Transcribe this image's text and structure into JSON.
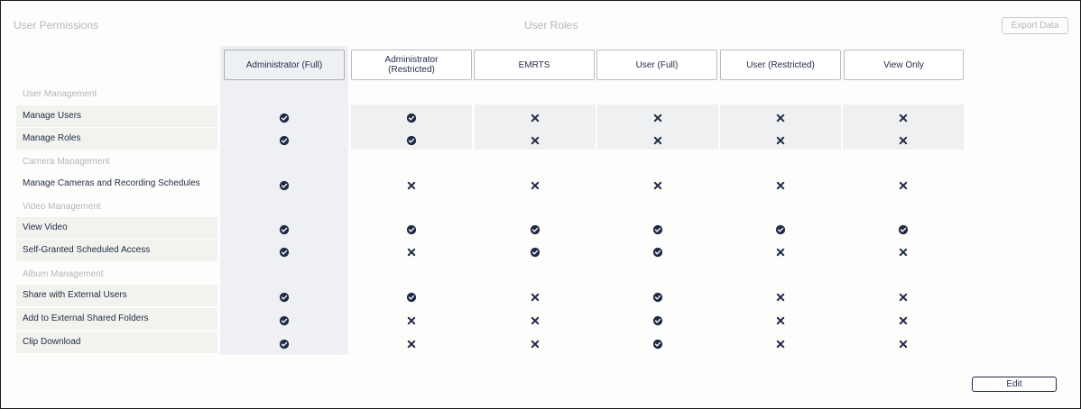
{
  "header": {
    "left_title": "User Permissions",
    "center_title": "User Roles",
    "export_label": "Export Data"
  },
  "roles": [
    {
      "label": "Administrator (Full)"
    },
    {
      "label": "Administrator (Restricted)"
    },
    {
      "label": "EMRTS"
    },
    {
      "label": "User (Full)"
    },
    {
      "label": "User (Restricted)"
    },
    {
      "label": "View Only"
    }
  ],
  "sections": [
    {
      "label": "User Management",
      "permissions": [
        {
          "label": "Manage Users",
          "access": [
            "check",
            "check",
            "cross",
            "cross",
            "cross",
            "cross"
          ]
        },
        {
          "label": "Manage Roles",
          "access": [
            "check",
            "check",
            "cross",
            "cross",
            "cross",
            "cross"
          ]
        }
      ]
    },
    {
      "label": "Camera Management",
      "permissions": [
        {
          "label": "Manage Cameras and Recording Schedules",
          "access": [
            "check",
            "cross",
            "cross",
            "cross",
            "cross",
            "cross"
          ]
        }
      ]
    },
    {
      "label": "Video Management",
      "permissions": [
        {
          "label": "View Video",
          "access": [
            "check",
            "check",
            "check",
            "check",
            "check",
            "check"
          ]
        },
        {
          "label": "Self-Granted Scheduled Access",
          "access": [
            "check",
            "cross",
            "check",
            "check",
            "cross",
            "cross"
          ]
        }
      ]
    },
    {
      "label": "Album Management",
      "permissions": [
        {
          "label": "Share with External Users",
          "access": [
            "check",
            "check",
            "cross",
            "check",
            "cross",
            "cross"
          ]
        },
        {
          "label": "Add to External Shared Folders",
          "access": [
            "check",
            "cross",
            "cross",
            "check",
            "cross",
            "cross"
          ]
        },
        {
          "label": "Clip Download",
          "access": [
            "check",
            "cross",
            "cross",
            "check",
            "cross",
            "cross"
          ]
        }
      ]
    }
  ],
  "footer": {
    "edit_label": "Edit"
  },
  "icons": {
    "check": "check-circle-icon",
    "cross": "cross-icon"
  },
  "colors": {
    "ink": "#1f2a44",
    "muted": "#b3b6bd",
    "row_shade": "#eff0f2"
  }
}
